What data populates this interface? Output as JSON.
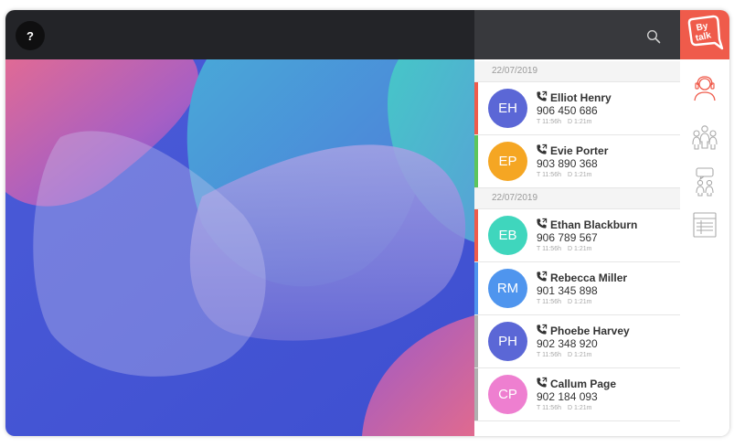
{
  "topbar": {
    "help_label": "?"
  },
  "logo": {
    "line1": "By",
    "line2": "talk"
  },
  "colors": {
    "accent": "#ef5b4b",
    "stripe_red": "#ef5b4b",
    "stripe_green": "#5cc55c",
    "stripe_blue": "#4f95ee",
    "stripe_gray": "#b0b0b0"
  },
  "groups": [
    {
      "date": "22/07/2019",
      "calls": [
        {
          "initials": "EH",
          "name": "Elliot Henry",
          "number": "906 450 686",
          "time": "T 11:56h",
          "duration": "D 1:21m",
          "avatar_color": "#5b67d6",
          "stripe": "#ef5b4b"
        },
        {
          "initials": "EP",
          "name": "Evie Porter",
          "number": "903 890 368",
          "time": "T 11:56h",
          "duration": "D 1:21m",
          "avatar_color": "#f5a623",
          "stripe": "#5cc55c"
        }
      ]
    },
    {
      "date": "22/07/2019",
      "calls": [
        {
          "initials": "EB",
          "name": "Ethan Blackburn",
          "number": "906 789 567",
          "time": "T 11:56h",
          "duration": "D 1:21m",
          "avatar_color": "#3fd6bd",
          "stripe": "#ef5b4b"
        },
        {
          "initials": "RM",
          "name": "Rebecca Miller",
          "number": "901 345 898",
          "time": "T 11:56h",
          "duration": "D 1:21m",
          "avatar_color": "#4f95ee",
          "stripe": "#4f95ee"
        },
        {
          "initials": "PH",
          "name": "Phoebe Harvey",
          "number": "902 348 920",
          "time": "T 11:56h",
          "duration": "D 1:21m",
          "avatar_color": "#5b67d6",
          "stripe": "#b0b0b0"
        },
        {
          "initials": "CP",
          "name": "Callum Page",
          "number": "902 184 093",
          "time": "T 11:56h",
          "duration": "D 1:21m",
          "avatar_color": "#ee7fd0",
          "stripe": "#b0b0b0"
        }
      ]
    }
  ],
  "rail_icons": [
    "agent-headset-icon",
    "contacts-group-icon",
    "chat-users-icon",
    "report-table-icon"
  ]
}
